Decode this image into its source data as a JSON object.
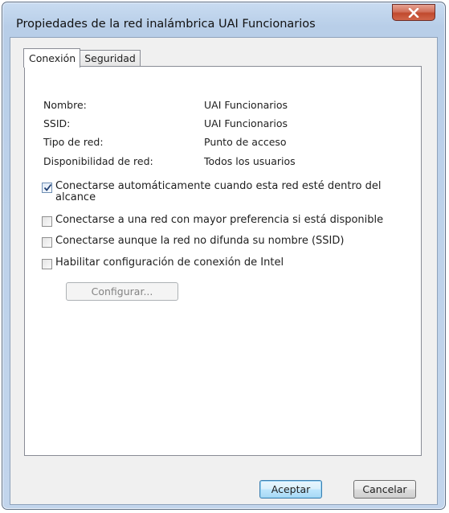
{
  "window": {
    "title": "Propiedades de la red inalámbrica UAI Funcionarios"
  },
  "tabs": [
    {
      "label": "Conexión",
      "active": true
    },
    {
      "label": "Seguridad",
      "active": false
    }
  ],
  "info": [
    {
      "label": "Nombre:",
      "value": "UAI Funcionarios"
    },
    {
      "label": "SSID:",
      "value": "UAI Funcionarios"
    },
    {
      "label": "Tipo de red:",
      "value": "Punto de acceso"
    },
    {
      "label": "Disponibilidad de red:",
      "value": "Todos los usuarios"
    }
  ],
  "options": [
    {
      "label": "Conectarse automáticamente cuando esta red esté dentro del alcance",
      "checked": true
    },
    {
      "label": "Conectarse a una red con mayor preferencia si está disponible",
      "checked": false
    },
    {
      "label": "Conectarse aunque la red no difunda su nombre (SSID)",
      "checked": false
    },
    {
      "label": "Habilitar configuración de conexión de Intel",
      "checked": false
    }
  ],
  "buttons": {
    "configure": "Configurar...",
    "ok": "Aceptar",
    "cancel": "Cancelar"
  },
  "icons": {
    "close": "close-icon",
    "check": "checkmark-icon"
  },
  "colors": {
    "close_button": "#c8553a",
    "default_button_border": "#3c7fb1",
    "frame": "#bcd1ea"
  }
}
